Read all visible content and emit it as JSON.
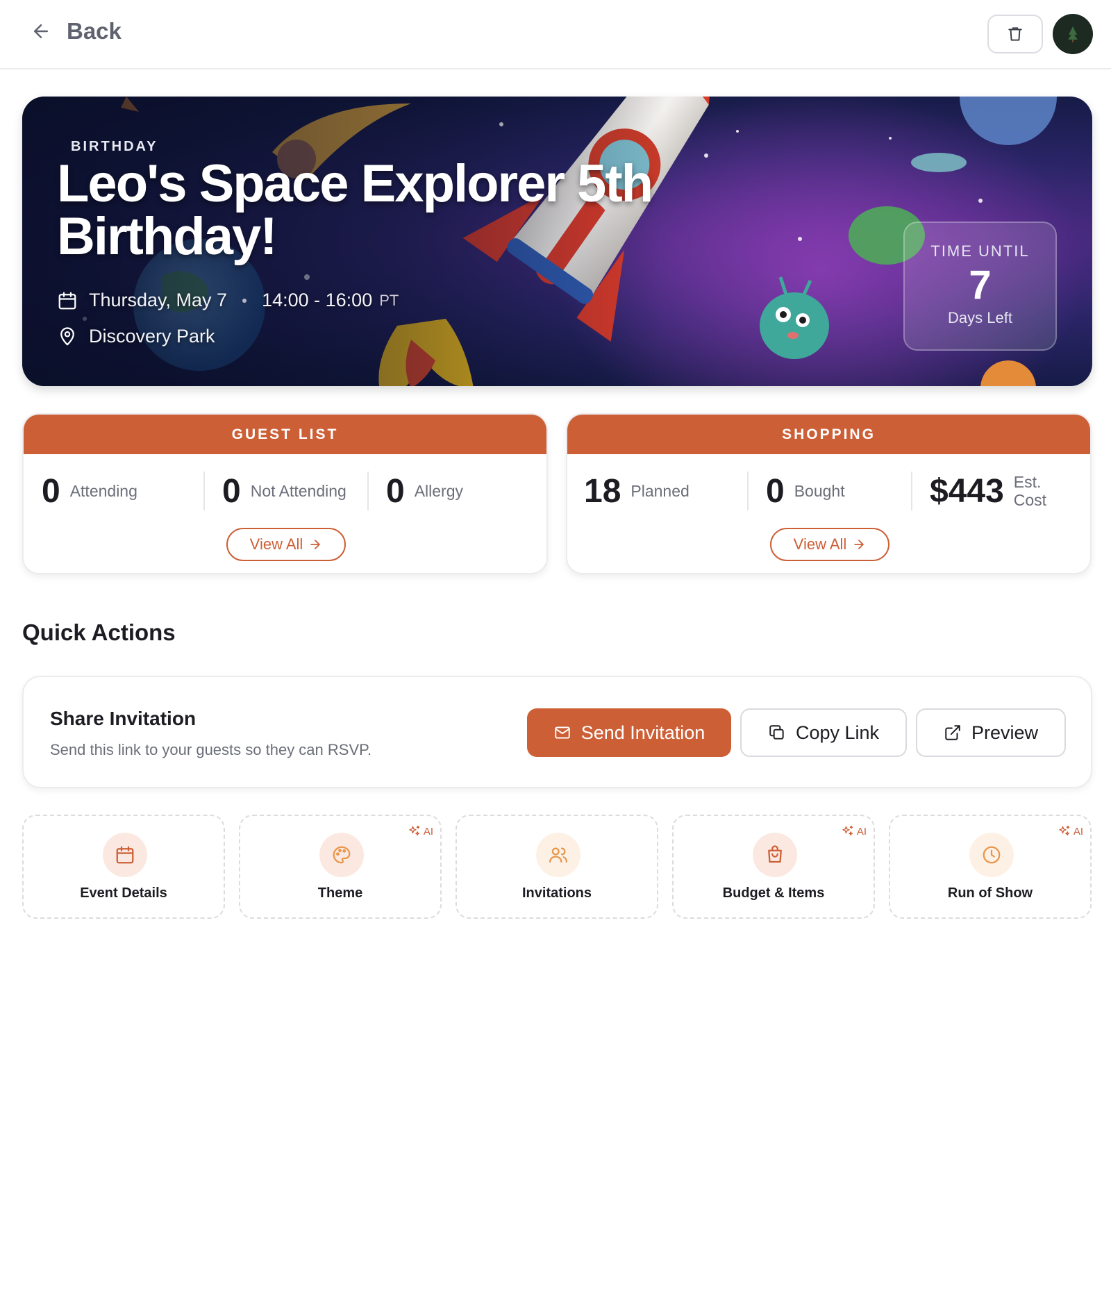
{
  "header": {
    "back_label": "Back"
  },
  "hero": {
    "category": "BIRTHDAY",
    "title": "Leo's Space Explorer 5th Birthday!",
    "date": "Thursday, May 7",
    "time": "14:00 - 16:00",
    "timezone": "PT",
    "location": "Discovery Park",
    "countdown": {
      "label": "TIME UNTIL",
      "value": "7",
      "unit": "Days Left"
    }
  },
  "guest_list": {
    "header": "GUEST LIST",
    "stats": [
      {
        "value": "0",
        "label": "Attending"
      },
      {
        "value": "0",
        "label": "Not Attending"
      },
      {
        "value": "0",
        "label": "Allergy"
      }
    ],
    "view_all": "View All"
  },
  "shopping": {
    "header": "SHOPPING",
    "stats": [
      {
        "value": "18",
        "label": "Planned"
      },
      {
        "value": "0",
        "label": "Bought"
      },
      {
        "value": "$443",
        "label_line1": "Est.",
        "label_line2": "Cost"
      }
    ],
    "view_all": "View All"
  },
  "quick_actions": {
    "title": "Quick Actions",
    "share": {
      "title": "Share Invitation",
      "description": "Send this link to your guests so they can RSVP.",
      "send_label": "Send Invitation",
      "copy_label": "Copy Link",
      "preview_label": "Preview"
    },
    "tiles": [
      {
        "label": "Event Details",
        "icon": "calendar-icon",
        "ai": false
      },
      {
        "label": "Theme",
        "icon": "palette-icon",
        "ai": true
      },
      {
        "label": "Invitations",
        "icon": "users-icon",
        "ai": false
      },
      {
        "label": "Budget & Items",
        "icon": "shopping-bag-icon",
        "ai": true
      },
      {
        "label": "Run of Show",
        "icon": "clock-icon",
        "ai": true
      }
    ],
    "ai_badge": "AI"
  },
  "colors": {
    "accent": "#cd5f36",
    "accent_soft": "#fbe9e1"
  }
}
